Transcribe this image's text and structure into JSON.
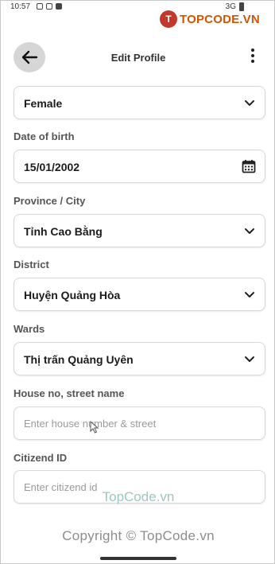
{
  "status_bar": {
    "time": "10:57",
    "network": "3G"
  },
  "watermark_logo": {
    "mark": "T",
    "text": "TOPCODE.VN"
  },
  "header": {
    "title": "Edit Profile"
  },
  "form": {
    "gender": {
      "value": "Female"
    },
    "date_of_birth": {
      "label": "Date of birth",
      "value": "15/01/2002"
    },
    "province": {
      "label": "Province / City",
      "value": "Tỉnh Cao Bằng"
    },
    "district": {
      "label": "District",
      "value": "Huyện Quảng Hòa"
    },
    "wards": {
      "label": "Wards",
      "value": "Thị trấn Quảng Uyên"
    },
    "house": {
      "label": "House no, street name",
      "placeholder": "Enter house number & street"
    },
    "citizen": {
      "label": "Citizend ID",
      "placeholder": "Enter citizend id"
    }
  },
  "watermarks": {
    "site": "TopCode.vn",
    "copyright": "Copyright © TopCode.vn"
  }
}
